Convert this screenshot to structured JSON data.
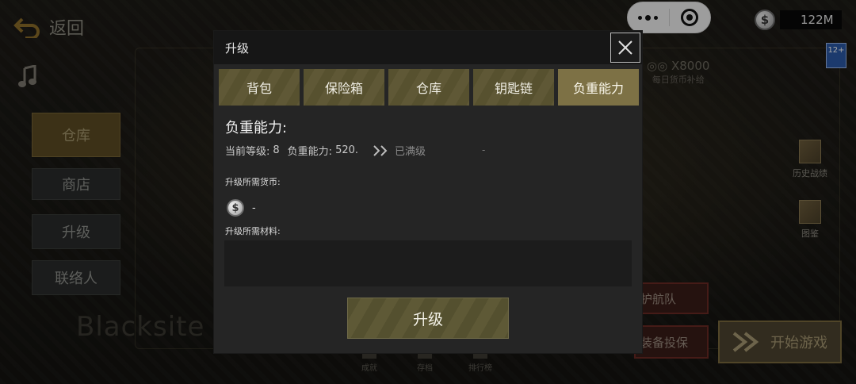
{
  "background": {
    "back_label": "返回",
    "side_nav": [
      "仓库",
      "商店",
      "升级",
      "联络人"
    ],
    "ghost_text": "Blacksite",
    "currency_amount": "122M",
    "age_rating": "12+",
    "subsidy_amount": "X8000",
    "subsidy_label": "每日货币补给",
    "right_icons": [
      "历史战绩",
      "图鉴"
    ],
    "escort_label": "护航队",
    "airdrop_label": "装备投保",
    "start_label": "开始游戏",
    "bottom_icons": [
      "成就",
      "存档",
      "排行榜"
    ]
  },
  "modal": {
    "title": "升级",
    "tabs": [
      {
        "label": "背包",
        "active": false
      },
      {
        "label": "保险箱",
        "active": false
      },
      {
        "label": "仓库",
        "active": false
      },
      {
        "label": "钥匙链",
        "active": false
      },
      {
        "label": "负重能力",
        "active": true
      }
    ],
    "section_title": "负重能力:",
    "current_level_label": "当前等级:",
    "current_level_value": "8",
    "capacity_label": "负重能力:",
    "capacity_value": "520.",
    "maxed_label": "已满级",
    "right_dash": "-",
    "required_currency_label": "升级所需货币:",
    "required_currency_value": "-",
    "required_materials_label": "升级所需材料:",
    "upgrade_button": "升级"
  },
  "colors": {
    "tab_active": "#7d7145",
    "tab_inactive": "#5b5432",
    "modal_bg": "#252525",
    "header_bg": "#161616"
  }
}
